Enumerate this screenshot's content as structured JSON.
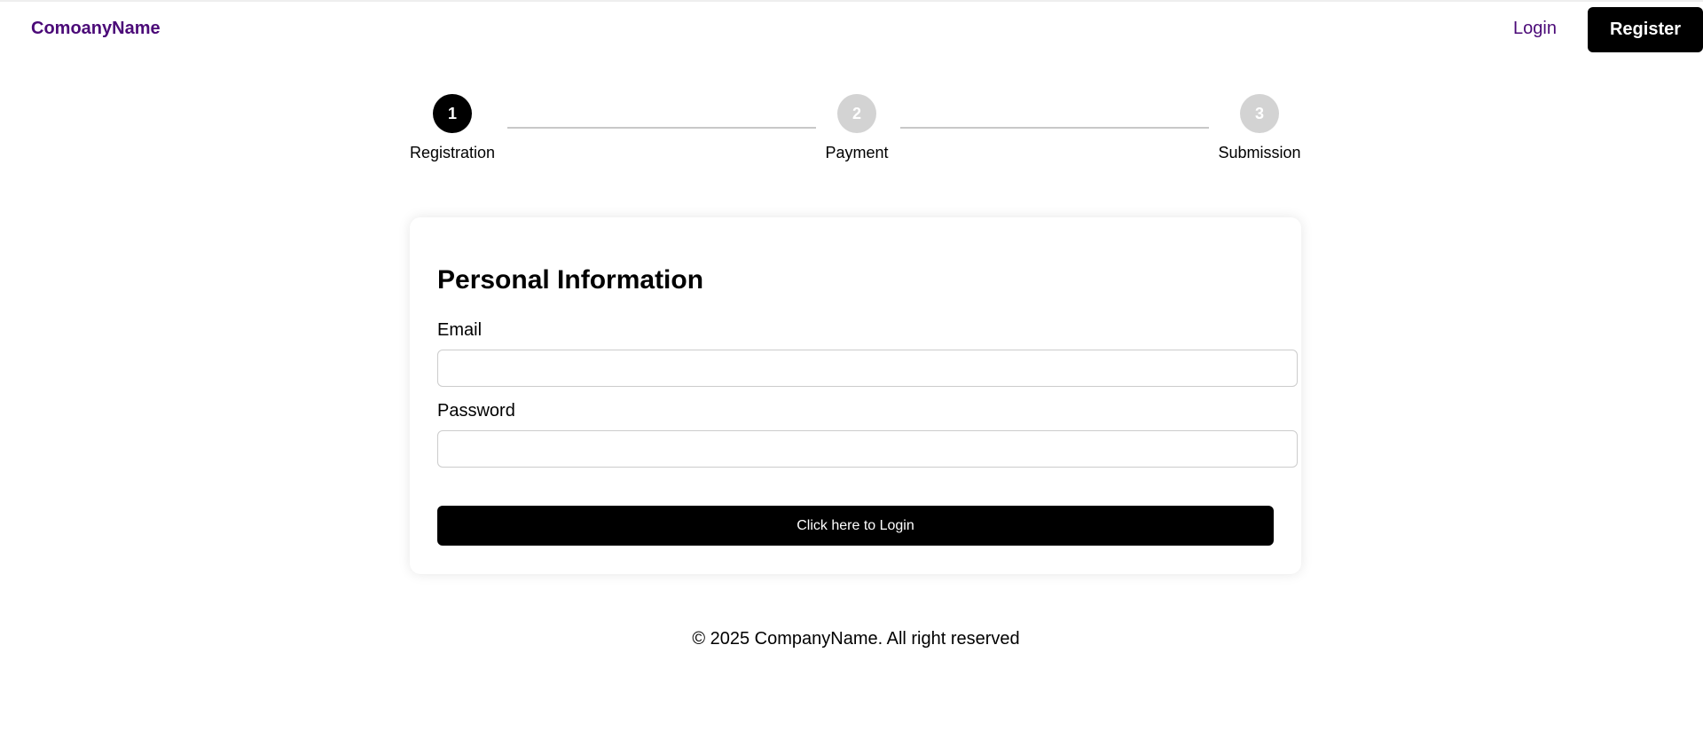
{
  "header": {
    "brand": "ComoanyName",
    "login_label": "Login",
    "register_label": "Register",
    "accent_color": "#4b0a78"
  },
  "stepper": {
    "steps": [
      {
        "number": "1",
        "label": "Registration",
        "state": "active"
      },
      {
        "number": "2",
        "label": "Payment",
        "state": "inactive"
      },
      {
        "number": "3",
        "label": "Submission",
        "state": "inactive"
      }
    ]
  },
  "form": {
    "title": "Personal Information",
    "email_label": "Email",
    "email_value": "",
    "password_label": "Password",
    "password_value": "",
    "submit_label": "Click here to Login"
  },
  "footer": {
    "text": "© 2025 CompanyName. All right reserved"
  }
}
